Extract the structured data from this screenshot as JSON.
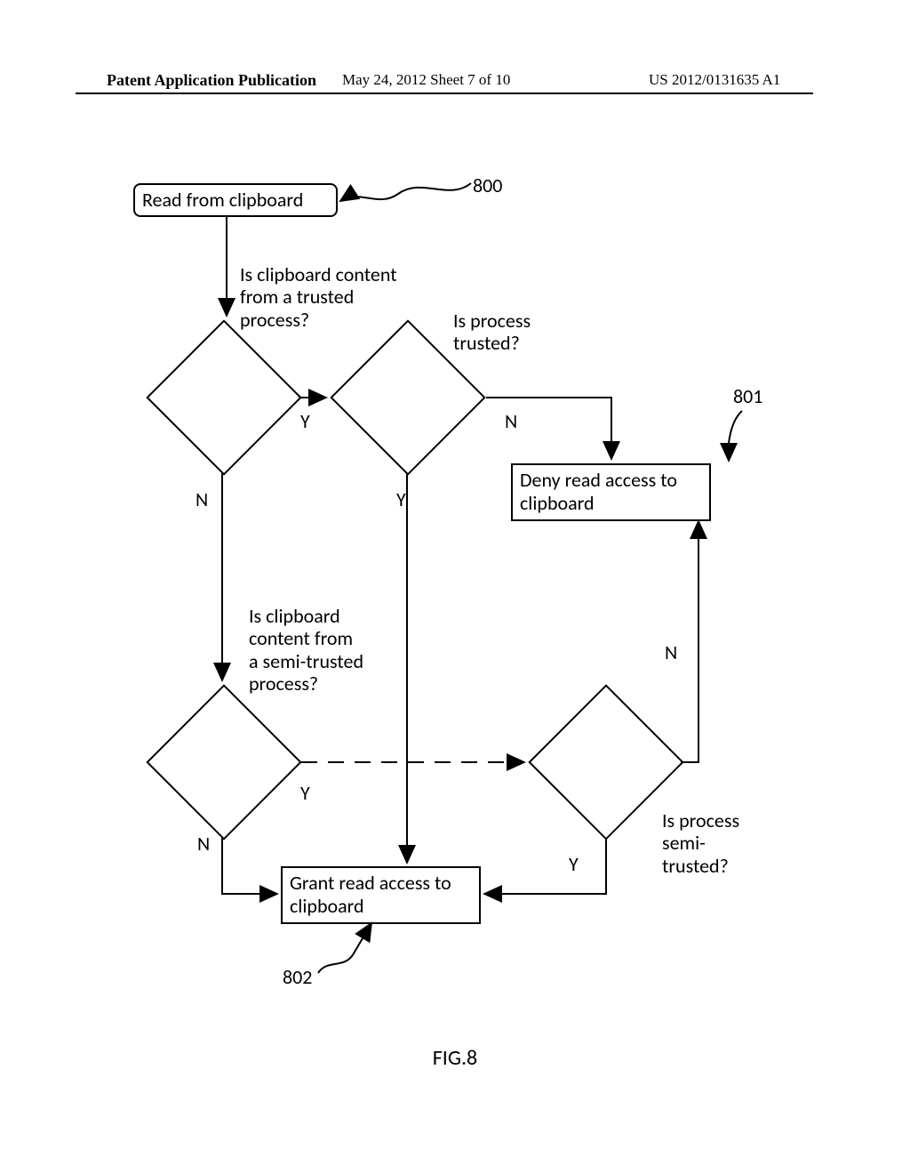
{
  "header": {
    "left": "Patent Application Publication",
    "mid": "May 24, 2012   Sheet 7 of 10",
    "right": "US 2012/0131635 A1"
  },
  "nodes": {
    "start": "Read from clipboard",
    "deny": "Deny read access to clipboard",
    "grant": "Grant read access to clipboard"
  },
  "questions": {
    "q1": "Is clipboard content\nfrom a trusted\nprocess?",
    "q2": "Is process\ntrusted?",
    "q3": "Is clipboard\ncontent from\na semi-trusted\nprocess?",
    "q4": "Is process\nsemi-\ntrusted?"
  },
  "edges": {
    "d1_y": "Y",
    "d1_n": "N",
    "d2_y": "Y",
    "d2_n": "N",
    "d3_y": "Y",
    "d3_n": "N",
    "d4_y": "Y",
    "d4_n": "N"
  },
  "refs": {
    "r800": "800",
    "r801": "801",
    "r802": "802"
  },
  "figure": "FIG.8",
  "chart_data": {
    "type": "flowchart",
    "title": "FIG.8",
    "nodes": [
      {
        "id": "start",
        "type": "terminator",
        "label": "Read from clipboard",
        "ref": "800"
      },
      {
        "id": "d1",
        "type": "decision",
        "label": "Is clipboard content from a trusted process?"
      },
      {
        "id": "d2",
        "type": "decision",
        "label": "Is process trusted?"
      },
      {
        "id": "d3",
        "type": "decision",
        "label": "Is clipboard content from a semi-trusted process?"
      },
      {
        "id": "d4",
        "type": "decision",
        "label": "Is process semi-trusted?"
      },
      {
        "id": "deny",
        "type": "process",
        "label": "Deny read access to clipboard",
        "ref": "801"
      },
      {
        "id": "grant",
        "type": "process",
        "label": "Grant read access to clipboard",
        "ref": "802"
      }
    ],
    "edges": [
      {
        "from": "start",
        "to": "d1"
      },
      {
        "from": "d1",
        "to": "d2",
        "label": "Y"
      },
      {
        "from": "d1",
        "to": "d3",
        "label": "N"
      },
      {
        "from": "d2",
        "to": "grant",
        "label": "Y"
      },
      {
        "from": "d2",
        "to": "deny",
        "label": "N"
      },
      {
        "from": "d3",
        "to": "d4",
        "label": "Y",
        "style": "dashed"
      },
      {
        "from": "d3",
        "to": "grant",
        "label": "N"
      },
      {
        "from": "d4",
        "to": "grant",
        "label": "Y"
      },
      {
        "from": "d4",
        "to": "deny",
        "label": "N"
      }
    ]
  }
}
